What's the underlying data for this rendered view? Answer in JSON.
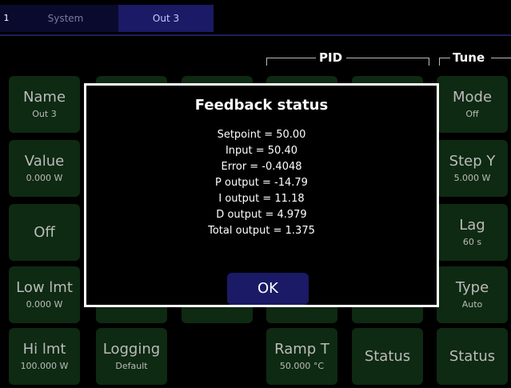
{
  "tabs": {
    "index": "1",
    "items": [
      {
        "label": "System"
      },
      {
        "label": "Out 3"
      }
    ]
  },
  "sections": {
    "pid": "PID",
    "tune": "Tune"
  },
  "left_column": [
    {
      "label": "Name",
      "value": "Out 3"
    },
    {
      "label": "Value",
      "value": "0.000 W"
    },
    {
      "label": "Off",
      "value": ""
    },
    {
      "label": "Low lmt",
      "value": "0.000 W"
    },
    {
      "label": "Hi lmt",
      "value": "100.000 W"
    }
  ],
  "bottom_row": [
    {
      "label": "Logging",
      "value": "Default"
    },
    {
      "label": "Ramp T",
      "value": "50.000 °C"
    },
    {
      "label": "Status",
      "value": ""
    },
    {
      "label": "Status",
      "value": ""
    }
  ],
  "tune_column": [
    {
      "label": "Mode",
      "value": "Off"
    },
    {
      "label": "Step Y",
      "value": "5.000 W"
    },
    {
      "label": "Lag",
      "value": "60 s"
    },
    {
      "label": "Type",
      "value": "Auto"
    }
  ],
  "modal": {
    "title": "Feedback status",
    "lines": [
      "Setpoint = 50.00",
      "Input = 50.40",
      "Error = -0.4048",
      "P output = -14.79",
      "I output = 11.18",
      "D output = 4.979",
      "Total output = 1.375"
    ],
    "ok_label": "OK"
  }
}
